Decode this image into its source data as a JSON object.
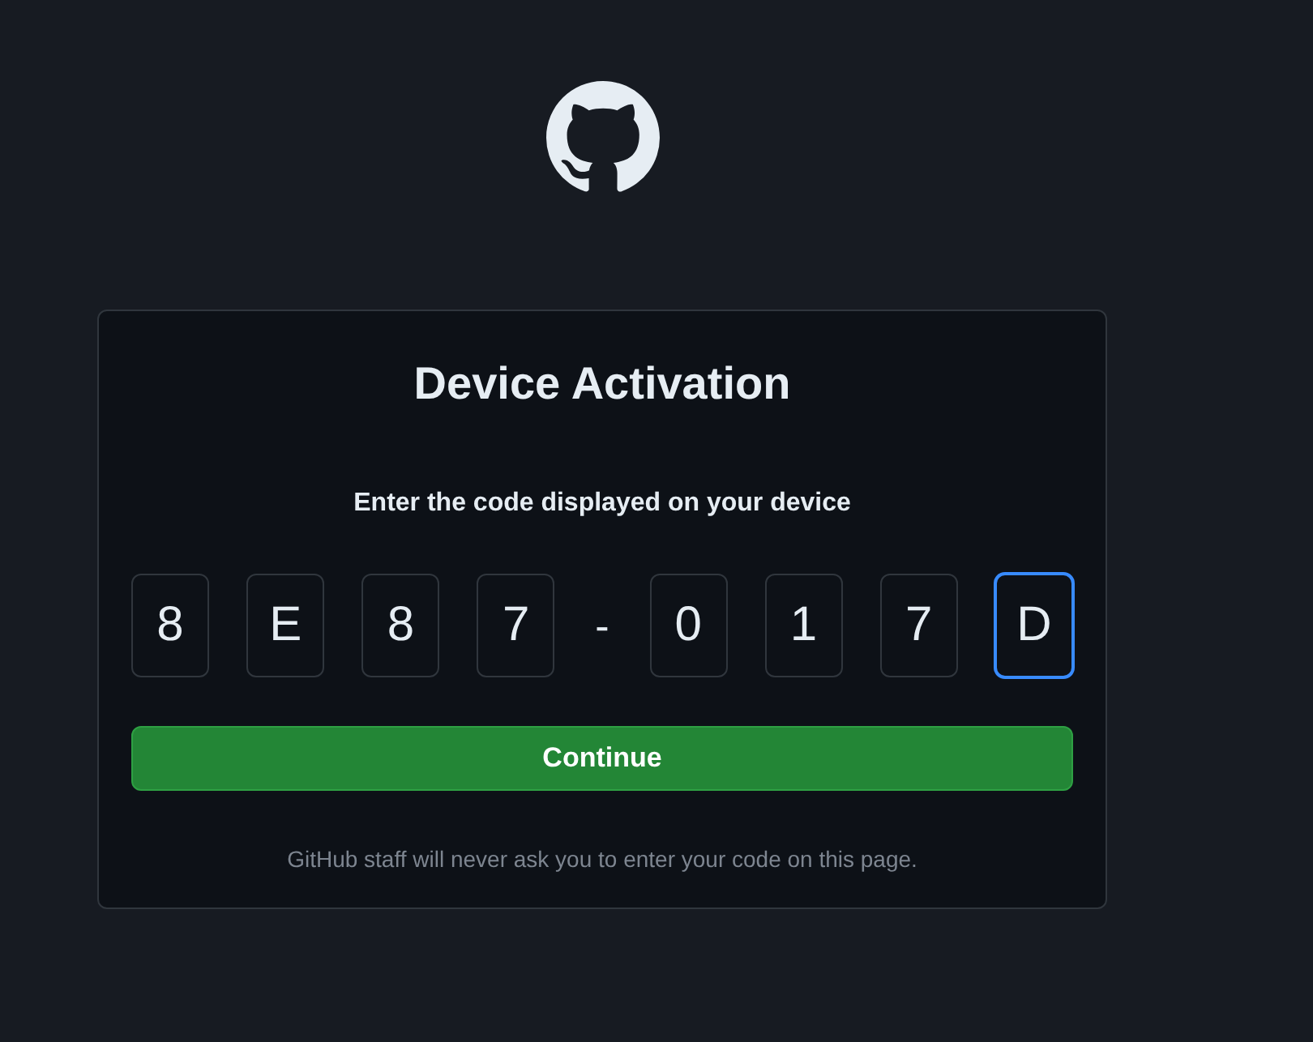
{
  "heading": "Device Activation",
  "instruction": "Enter the code displayed on your device",
  "code": [
    {
      "kind": "char",
      "value": "8",
      "focused": false
    },
    {
      "kind": "char",
      "value": "E",
      "focused": false
    },
    {
      "kind": "char",
      "value": "8",
      "focused": false
    },
    {
      "kind": "char",
      "value": "7",
      "focused": false
    },
    {
      "kind": "separator",
      "value": "-"
    },
    {
      "kind": "char",
      "value": "0",
      "focused": false
    },
    {
      "kind": "char",
      "value": "1",
      "focused": false
    },
    {
      "kind": "char",
      "value": "7",
      "focused": false
    },
    {
      "kind": "char",
      "value": "D",
      "focused": true
    }
  ],
  "button": {
    "label": "Continue"
  },
  "notice": "GitHub staff will never ask you to enter your code on this page."
}
